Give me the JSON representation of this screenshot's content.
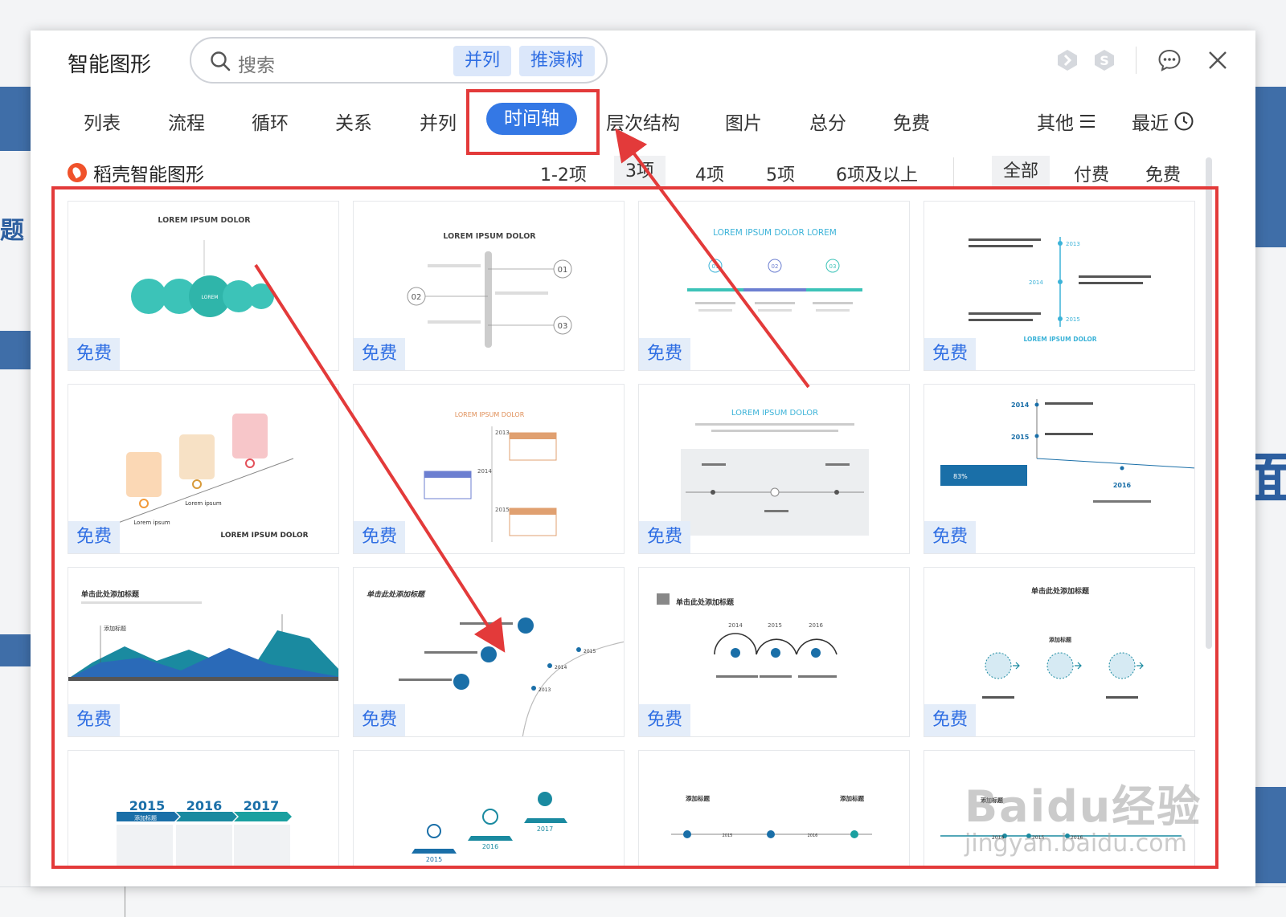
{
  "dialog": {
    "title": "智能图形",
    "search": {
      "placeholder": "搜索",
      "chips": [
        "并列",
        "推演树"
      ]
    },
    "top_icons": [
      "hex-badge-icon",
      "s-badge-icon",
      "comment-icon",
      "close-icon"
    ]
  },
  "tabs": {
    "items": [
      "列表",
      "流程",
      "循环",
      "关系",
      "并列",
      "时间轴",
      "层次结构",
      "图片",
      "总分",
      "免费"
    ],
    "active": "时间轴",
    "other_label": "其他",
    "recent_label": "最近"
  },
  "subbar": {
    "brand": "稻壳智能图形",
    "counts": [
      "1-2项",
      "3项",
      "4项",
      "5项",
      "6项及以上"
    ],
    "selected_count": "3项",
    "filters": [
      "全部",
      "付费",
      "免费"
    ],
    "selected_filter": "全部"
  },
  "cards": {
    "badge": "免费",
    "items": [
      {
        "texts": [
          "LOREM IPSUM DOLOR",
          "LOREM"
        ]
      },
      {
        "texts": [
          "LOREM IPSUM DOLOR",
          "01",
          "02",
          "03"
        ]
      },
      {
        "texts": [
          "LOREM IPSUM DOLOR LOREM",
          "01",
          "02",
          "03"
        ]
      },
      {
        "texts": [
          "LOREM IPSUM DOLOR",
          "2013",
          "2014",
          "2015"
        ]
      },
      {
        "texts": [
          "Lorem ipsum",
          "Lorem ipsum",
          "LOREM IPSUM DOLOR"
        ]
      },
      {
        "texts": [
          "LOREM IPSUM DOLOR",
          "2013",
          "2014",
          "2015"
        ]
      },
      {
        "texts": [
          "LOREM IPSUM DOLOR"
        ]
      },
      {
        "texts": [
          "2014",
          "2015",
          "2016",
          "83%"
        ]
      },
      {
        "texts": [
          "单击此处添加标题",
          "添加标题"
        ]
      },
      {
        "texts": [
          "单击此处添加标题",
          "2013",
          "2014",
          "2015"
        ]
      },
      {
        "texts": [
          "单击此处添加标题",
          "2014",
          "2015",
          "2016"
        ]
      },
      {
        "texts": [
          "单击此处添加标题",
          "添加标题"
        ]
      },
      {
        "texts": [
          "2015",
          "2016",
          "2017",
          "添加标题"
        ]
      },
      {
        "texts": [
          "2015",
          "2016",
          "2017"
        ]
      },
      {
        "texts": [
          "添加标题",
          "添加标题",
          "2015",
          "2016"
        ]
      },
      {
        "texts": [
          "添加标题",
          "2014",
          "2015",
          "2016"
        ]
      }
    ]
  },
  "watermark": {
    "line1": "Baidu经验",
    "line2": "jingyan.baidu.com"
  },
  "colors": {
    "accent": "#3478e5",
    "highlight": "#e33a3a",
    "teal": "#3cc3b8",
    "badge_bg": "#e4edf9"
  }
}
